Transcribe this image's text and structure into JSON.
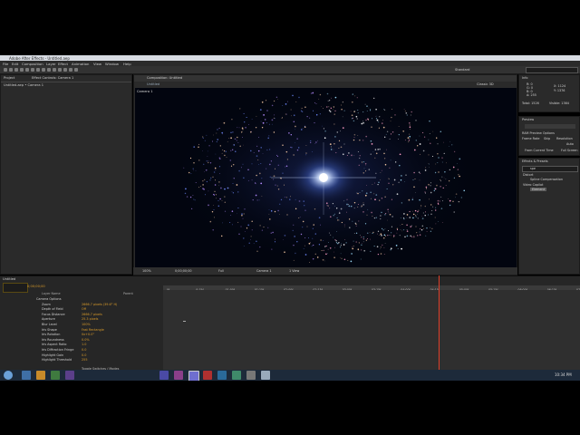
{
  "window": {
    "title": "Adobe After Effects - Untitled.aep"
  },
  "menu": [
    "File",
    "Edit",
    "Composition",
    "Layer",
    "Effect",
    "Animation",
    "View",
    "Window",
    "Help"
  ],
  "left_panel": {
    "tab": "Project",
    "tab2": "Effect Controls: Camera 1",
    "header": "Untitled.aep • Camera 1"
  },
  "comp": {
    "tab": "Composition: Untitled",
    "label": "Camera 1",
    "view": "Untitled",
    "right_label": "Standard",
    "right_tab": "Classic 3D"
  },
  "viewer_footer": {
    "zoom": "100%",
    "time": "0;00;00;00",
    "resolution": "Full",
    "camera": "Camera 1",
    "views": "1 View"
  },
  "info": {
    "r": "R: 0",
    "g": "G: 0",
    "b": "B: 0",
    "a": "A: 255",
    "x": "X: 1124",
    "y": "Y: 1376",
    "total": "Total: 1526",
    "visible": "Visible: 1364"
  },
  "preview": {
    "label": "Preview",
    "ram_label": "RAM Preview Options",
    "frame_rate": "Frame Rate",
    "skip": "Skip",
    "resolution": "Resolution",
    "auto": "Auto",
    "from_current": "From Current Time",
    "full_screen": "Full Screen"
  },
  "effects": {
    "label": "Effects & Presets",
    "search": "spe",
    "item1": "Distort",
    "item2": "Spline Compensation",
    "item3": "Video Copilot",
    "item4": "Element"
  },
  "timeline": {
    "comp_name": "Untitled",
    "time": "0;00;00;00",
    "layer_header": "Layer Name",
    "parent_header": "Parent",
    "rows": [
      {
        "name": "Camera Options",
        "value": ""
      },
      {
        "name": "Zoom",
        "value": "2666.7 pixels (39.6° H)"
      },
      {
        "name": "Depth of Field",
        "value": "Off"
      },
      {
        "name": "Focus Distance",
        "value": "2666.7 pixels"
      },
      {
        "name": "Aperture",
        "value": "25.3 pixels"
      },
      {
        "name": "Blur Level",
        "value": "100%"
      },
      {
        "name": "Iris Shape",
        "value": "Fast Rectangle"
      },
      {
        "name": "Iris Rotation",
        "value": "0x+0.0°"
      },
      {
        "name": "Iris Roundness",
        "value": "0.0%"
      },
      {
        "name": "Iris Aspect Ratio",
        "value": "1.0"
      },
      {
        "name": "Iris Diffraction Fringe",
        "value": "0.0"
      },
      {
        "name": "Highlight Gain",
        "value": "0.0"
      },
      {
        "name": "Highlight Threshold",
        "value": "255"
      }
    ],
    "footer": "Toggle Switches / Modes",
    "playhead_fraction": 0.66,
    "ruler": [
      "0f",
      "0:15f",
      "01:00f",
      "01:15f",
      "02:00f",
      "02:15f",
      "03:00f",
      "03:15f",
      "04:00f",
      "04:15f",
      "05:00f",
      "05:15f",
      "06:00f",
      "06:15f",
      "07:00f"
    ]
  },
  "clock": "10:34 PM",
  "colors": {
    "accent": "#d89a2a",
    "viewer_bg": "#02050f",
    "panel": "#2a2a2a"
  }
}
